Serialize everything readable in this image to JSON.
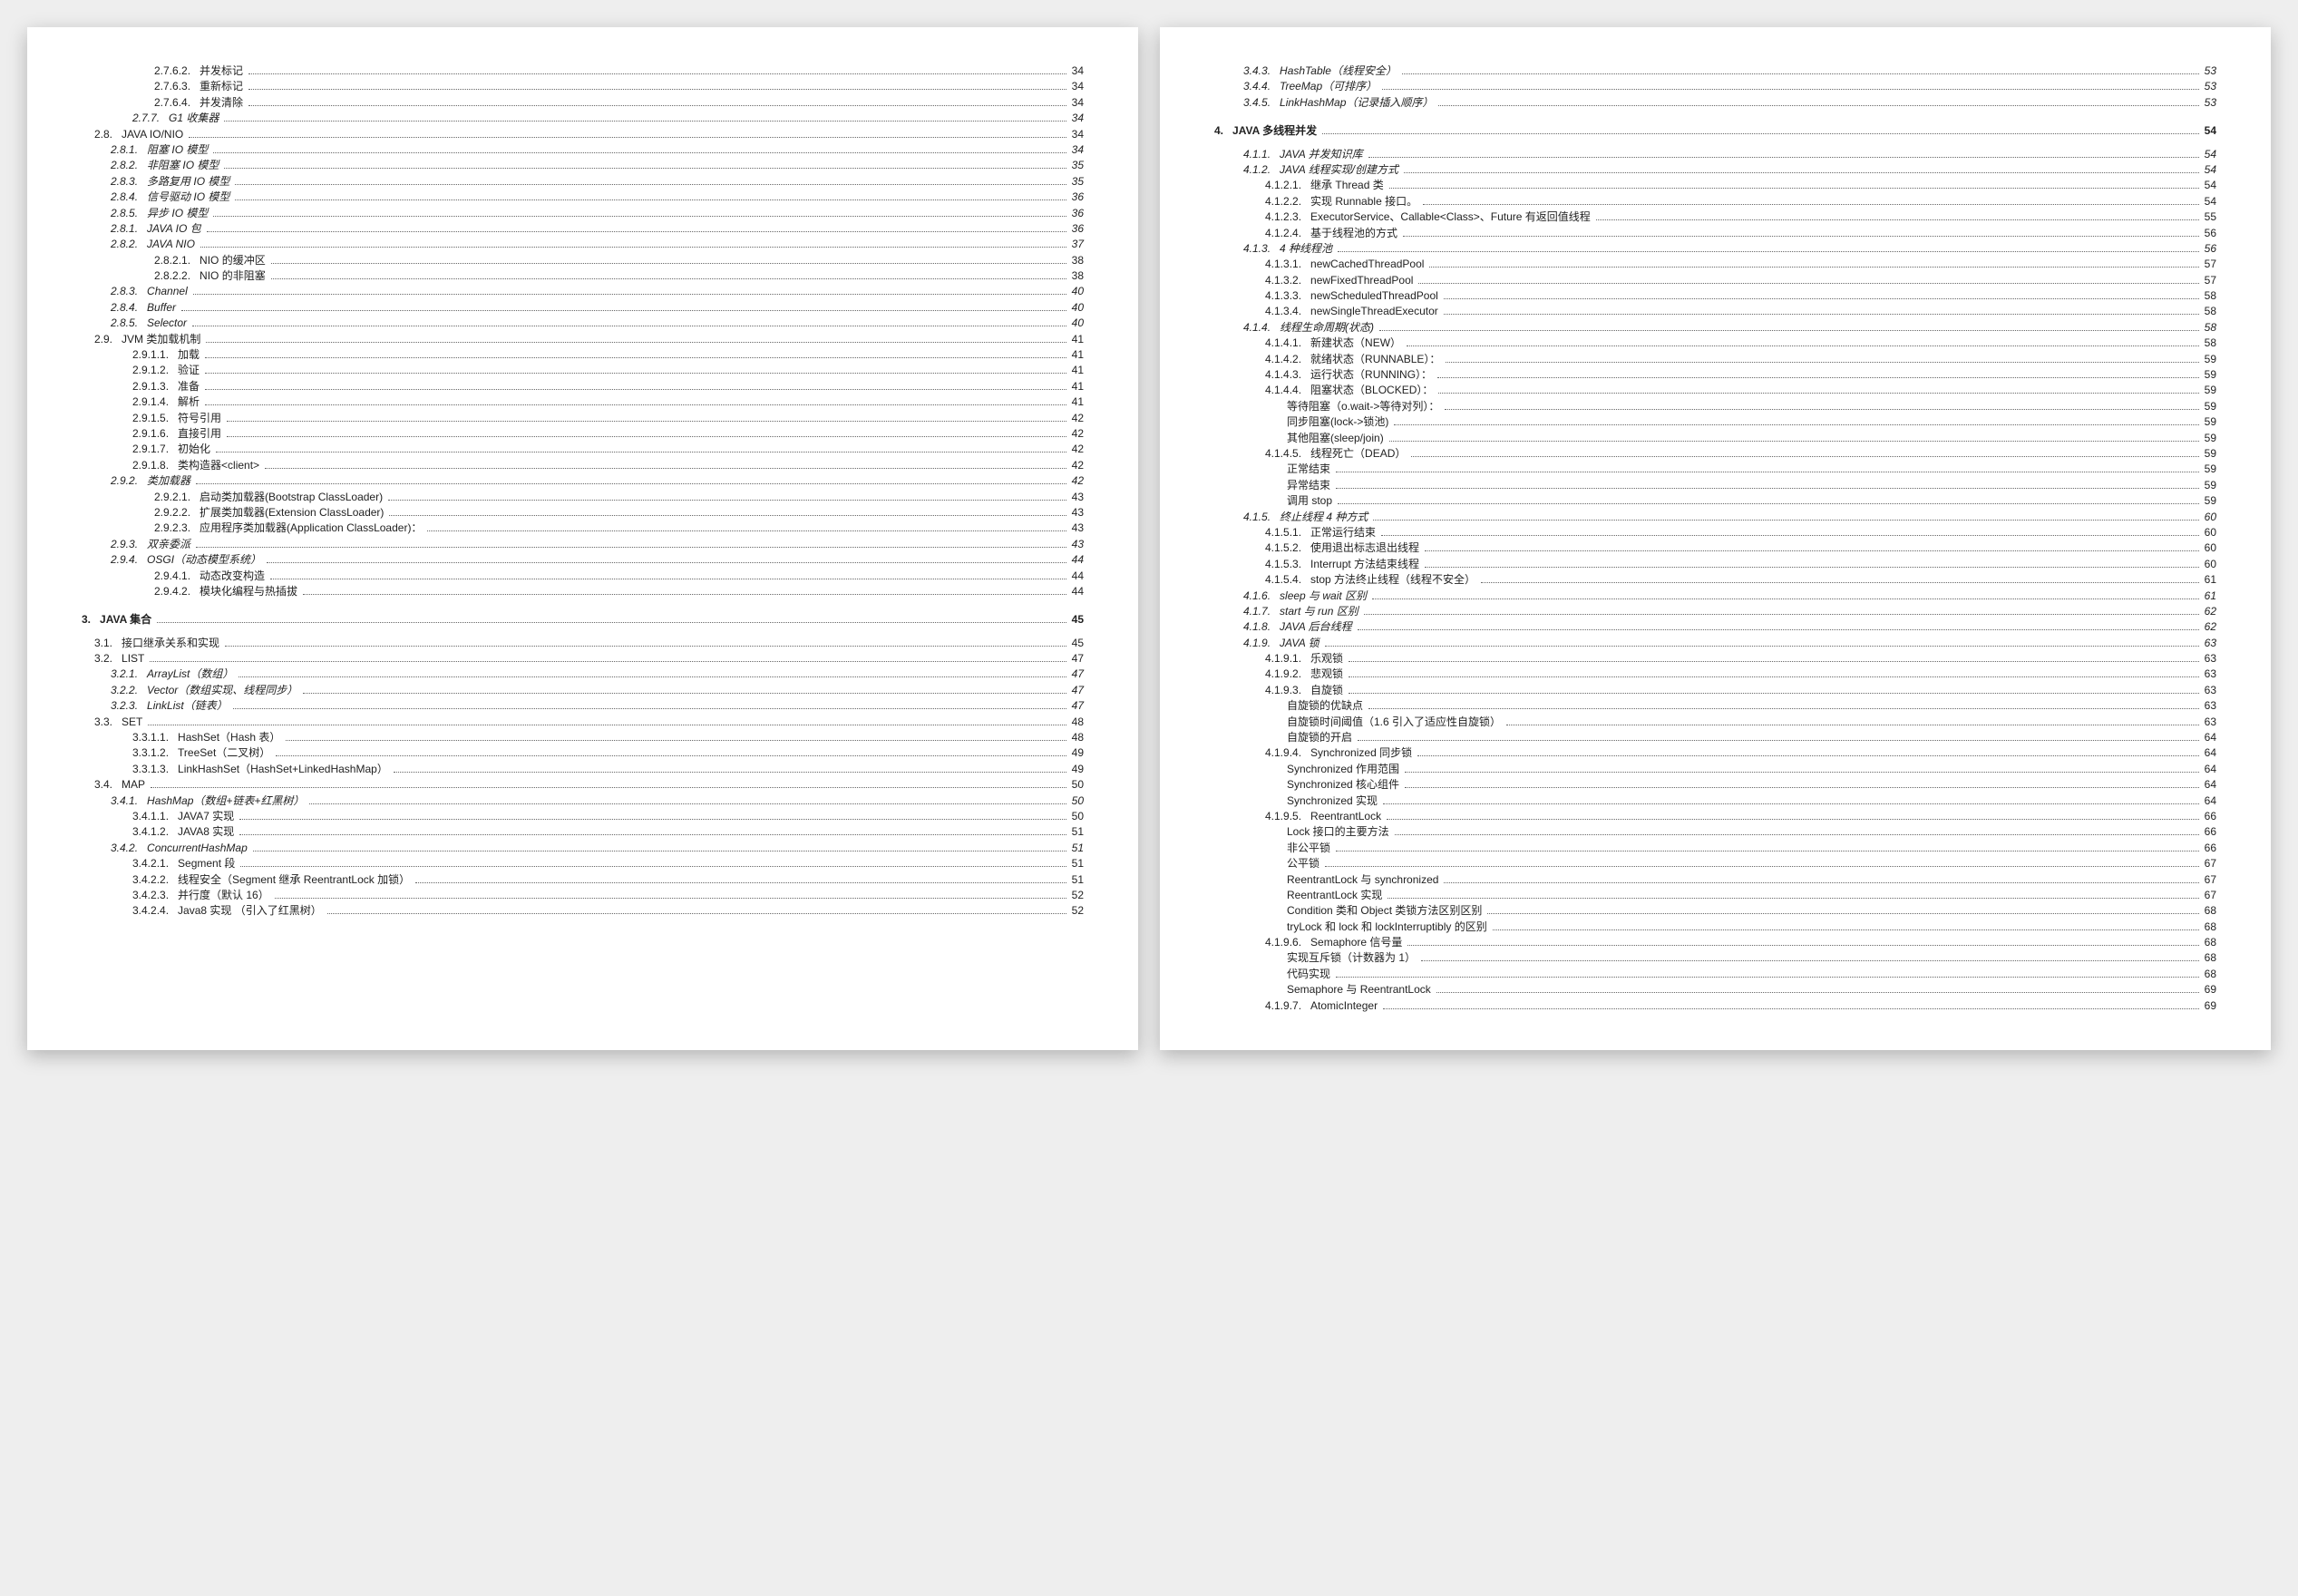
{
  "left": [
    {
      "lvl": "lvl4",
      "num": "2.7.6.2.",
      "label": "并发标记",
      "pg": "34"
    },
    {
      "lvl": "lvl4",
      "num": "2.7.6.3.",
      "label": "重新标记",
      "pg": "34"
    },
    {
      "lvl": "lvl4",
      "num": "2.7.6.4.",
      "label": "并发清除",
      "pg": "34"
    },
    {
      "lvl": "lvl3",
      "num": "2.7.7.",
      "label": "G1 收集器",
      "pg": "34",
      "ital": true
    },
    {
      "lvl": "lvl1",
      "num": "2.8.",
      "label": "JAVA IO/NIO",
      "pg": "34"
    },
    {
      "lvl": "lvl2",
      "num": "2.8.1.",
      "label": "阻塞 IO 模型",
      "pg": "34"
    },
    {
      "lvl": "lvl2",
      "num": "2.8.2.",
      "label": "非阻塞 IO 模型",
      "pg": "35"
    },
    {
      "lvl": "lvl2",
      "num": "2.8.3.",
      "label": "多路复用 IO 模型",
      "pg": "35"
    },
    {
      "lvl": "lvl2",
      "num": "2.8.4.",
      "label": "信号驱动 IO 模型",
      "pg": "36"
    },
    {
      "lvl": "lvl2",
      "num": "2.8.5.",
      "label": "异步 IO 模型",
      "pg": "36"
    },
    {
      "lvl": "lvl2",
      "num": "2.8.1.",
      "label": "JAVA IO 包",
      "pg": "36"
    },
    {
      "lvl": "lvl2",
      "num": "2.8.2.",
      "label": "JAVA NIO",
      "pg": "37"
    },
    {
      "lvl": "lvl4",
      "num": "2.8.2.1.",
      "label": "NIO 的缓冲区",
      "pg": "38"
    },
    {
      "lvl": "lvl4",
      "num": "2.8.2.2.",
      "label": "NIO 的非阻塞",
      "pg": "38"
    },
    {
      "lvl": "lvl2",
      "num": "2.8.3.",
      "label": "Channel",
      "pg": "40"
    },
    {
      "lvl": "lvl2",
      "num": "2.8.4.",
      "label": "Buffer",
      "pg": "40"
    },
    {
      "lvl": "lvl2",
      "num": "2.8.5.",
      "label": "Selector",
      "pg": "40"
    },
    {
      "lvl": "lvl1",
      "num": "2.9.",
      "label": "JVM 类加载机制",
      "pg": "41"
    },
    {
      "lvl": "lvl3",
      "num": "2.9.1.1.",
      "label": "加载",
      "pg": "41"
    },
    {
      "lvl": "lvl3",
      "num": "2.9.1.2.",
      "label": "验证",
      "pg": "41"
    },
    {
      "lvl": "lvl3",
      "num": "2.9.1.3.",
      "label": "准备",
      "pg": "41"
    },
    {
      "lvl": "lvl3",
      "num": "2.9.1.4.",
      "label": "解析",
      "pg": "41"
    },
    {
      "lvl": "lvl3",
      "num": "2.9.1.5.",
      "label": "符号引用",
      "pg": "42"
    },
    {
      "lvl": "lvl3",
      "num": "2.9.1.6.",
      "label": "直接引用",
      "pg": "42"
    },
    {
      "lvl": "lvl3",
      "num": "2.9.1.7.",
      "label": "初始化",
      "pg": "42"
    },
    {
      "lvl": "lvl3",
      "num": "2.9.1.8.",
      "label": "类构造器<client>",
      "pg": "42"
    },
    {
      "lvl": "lvl2",
      "num": "2.9.2.",
      "label": "类加载器",
      "pg": "42"
    },
    {
      "lvl": "lvl4",
      "num": "2.9.2.1.",
      "label": "启动类加载器(Bootstrap ClassLoader)",
      "pg": "43"
    },
    {
      "lvl": "lvl4",
      "num": "2.9.2.2.",
      "label": "扩展类加载器(Extension ClassLoader)",
      "pg": "43"
    },
    {
      "lvl": "lvl4",
      "num": "2.9.2.3.",
      "label": "应用程序类加载器(Application ClassLoader)：",
      "pg": "43"
    },
    {
      "lvl": "lvl2",
      "num": "2.9.3.",
      "label": "双亲委派",
      "pg": "43"
    },
    {
      "lvl": "lvl2",
      "num": "2.9.4.",
      "label": "OSGI（动态模型系统）",
      "pg": "44"
    },
    {
      "lvl": "lvl4",
      "num": "2.9.4.1.",
      "label": "动态改变构造",
      "pg": "44"
    },
    {
      "lvl": "lvl4",
      "num": "2.9.4.2.",
      "label": "模块化编程与热插拔",
      "pg": "44"
    },
    {
      "lvl": "lvl0",
      "num": "3.",
      "label": "JAVA 集合",
      "pg": "45"
    },
    {
      "lvl": "lvl1",
      "num": "3.1.",
      "label": "接口继承关系和实现",
      "pg": "45"
    },
    {
      "lvl": "lvl1",
      "num": "3.2.",
      "label": "LIST",
      "pg": "47",
      "sc": true
    },
    {
      "lvl": "lvl2",
      "num": "3.2.1.",
      "label": "ArrayList（数组）",
      "pg": "47"
    },
    {
      "lvl": "lvl2",
      "num": "3.2.2.",
      "label": "Vector（数组实现、线程同步）",
      "pg": "47"
    },
    {
      "lvl": "lvl2",
      "num": "3.2.3.",
      "label": "LinkList（链表）",
      "pg": "47"
    },
    {
      "lvl": "lvl1",
      "num": "3.3.",
      "label": "SET",
      "pg": "48",
      "sc": true
    },
    {
      "lvl": "lvl3",
      "num": "3.3.1.1.",
      "label": "HashSet（Hash 表）",
      "pg": "48"
    },
    {
      "lvl": "lvl3",
      "num": "3.3.1.2.",
      "label": "TreeSet（二叉树）",
      "pg": "49"
    },
    {
      "lvl": "lvl3",
      "num": "3.3.1.3.",
      "label": "LinkHashSet（HashSet+LinkedHashMap）",
      "pg": "49"
    },
    {
      "lvl": "lvl1",
      "num": "3.4.",
      "label": "MAP",
      "pg": "50",
      "sc": true
    },
    {
      "lvl": "lvl2",
      "num": "3.4.1.",
      "label": "HashMap（数组+链表+红黑树）",
      "pg": "50"
    },
    {
      "lvl": "lvl3",
      "num": "3.4.1.1.",
      "label": "JAVA7 实现",
      "pg": "50"
    },
    {
      "lvl": "lvl3",
      "num": "3.4.1.2.",
      "label": "JAVA8 实现",
      "pg": "51"
    },
    {
      "lvl": "lvl2",
      "num": "3.4.2.",
      "label": "ConcurrentHashMap",
      "pg": "51"
    },
    {
      "lvl": "lvl3",
      "num": "3.4.2.1.",
      "label": "Segment 段",
      "pg": "51"
    },
    {
      "lvl": "lvl3",
      "num": "3.4.2.2.",
      "label": "线程安全（Segment 继承 ReentrantLock 加锁）",
      "pg": "51"
    },
    {
      "lvl": "lvl3",
      "num": "3.4.2.3.",
      "label": "并行度（默认 16）",
      "pg": "52"
    },
    {
      "lvl": "lvl3",
      "num": "3.4.2.4.",
      "label": "Java8 实现 （引入了红黑树）",
      "pg": "52"
    }
  ],
  "right": [
    {
      "lvl": "lvl2",
      "num": "3.4.3.",
      "label": "HashTable（线程安全）",
      "pg": "53"
    },
    {
      "lvl": "lvl2",
      "num": "3.4.4.",
      "label": "TreeMap（可排序）",
      "pg": "53"
    },
    {
      "lvl": "lvl2",
      "num": "3.4.5.",
      "label": "LinkHashMap（记录插入顺序）",
      "pg": "53"
    },
    {
      "lvl": "lvl0",
      "num": "4.",
      "label": "JAVA 多线程并发",
      "pg": "54"
    },
    {
      "lvl": "lvl2",
      "num": "4.1.1.",
      "label": "JAVA 并发知识库",
      "pg": "54"
    },
    {
      "lvl": "lvl2",
      "num": "4.1.2.",
      "label": "JAVA 线程实现/创建方式",
      "pg": "54"
    },
    {
      "lvl": "lvl3",
      "num": "4.1.2.1.",
      "label": "继承 Thread 类",
      "pg": "54"
    },
    {
      "lvl": "lvl3",
      "num": "4.1.2.2.",
      "label": "实现 Runnable 接口。",
      "pg": "54"
    },
    {
      "lvl": "lvl3",
      "num": "4.1.2.3.",
      "label": "ExecutorService、Callable<Class>、Future 有返回值线程",
      "pg": "55"
    },
    {
      "lvl": "lvl3",
      "num": "4.1.2.4.",
      "label": "基于线程池的方式",
      "pg": "56"
    },
    {
      "lvl": "lvl2",
      "num": "4.1.3.",
      "label": "4 种线程池",
      "pg": "56"
    },
    {
      "lvl": "lvl3",
      "num": "4.1.3.1.",
      "label": "newCachedThreadPool",
      "pg": "57"
    },
    {
      "lvl": "lvl3",
      "num": "4.1.3.2.",
      "label": "newFixedThreadPool",
      "pg": "57"
    },
    {
      "lvl": "lvl3",
      "num": "4.1.3.3.",
      "label": "newScheduledThreadPool",
      "pg": "58"
    },
    {
      "lvl": "lvl3",
      "num": "4.1.3.4.",
      "label": "newSingleThreadExecutor",
      "pg": "58"
    },
    {
      "lvl": "lvl2",
      "num": "4.1.4.",
      "label": "线程生命周期(状态)",
      "pg": "58"
    },
    {
      "lvl": "lvl3",
      "num": "4.1.4.1.",
      "label": "新建状态（NEW）",
      "pg": "58"
    },
    {
      "lvl": "lvl3",
      "num": "4.1.4.2.",
      "label": "就绪状态（RUNNABLE）：",
      "pg": "59"
    },
    {
      "lvl": "lvl3",
      "num": "4.1.4.3.",
      "label": "运行状态（RUNNING）：",
      "pg": "59"
    },
    {
      "lvl": "lvl3",
      "num": "4.1.4.4.",
      "label": "阻塞状态（BLOCKED）：",
      "pg": "59"
    },
    {
      "lvl": "lvl4",
      "num": "",
      "label": "等待阻塞（o.wait->等待对列）：",
      "pg": "59"
    },
    {
      "lvl": "lvl4",
      "num": "",
      "label": "同步阻塞(lock->锁池)",
      "pg": "59"
    },
    {
      "lvl": "lvl4",
      "num": "",
      "label": "其他阻塞(sleep/join)",
      "pg": "59"
    },
    {
      "lvl": "lvl3",
      "num": "4.1.4.5.",
      "label": "线程死亡（DEAD）",
      "pg": "59"
    },
    {
      "lvl": "lvl4",
      "num": "",
      "label": "正常结束",
      "pg": "59"
    },
    {
      "lvl": "lvl4",
      "num": "",
      "label": "异常结束",
      "pg": "59"
    },
    {
      "lvl": "lvl4",
      "num": "",
      "label": "调用 stop",
      "pg": "59"
    },
    {
      "lvl": "lvl2",
      "num": "4.1.5.",
      "label": "终止线程 4 种方式",
      "pg": "60"
    },
    {
      "lvl": "lvl3",
      "num": "4.1.5.1.",
      "label": "正常运行结束",
      "pg": "60"
    },
    {
      "lvl": "lvl3",
      "num": "4.1.5.2.",
      "label": "使用退出标志退出线程",
      "pg": "60"
    },
    {
      "lvl": "lvl3",
      "num": "4.1.5.3.",
      "label": "Interrupt 方法结束线程",
      "pg": "60"
    },
    {
      "lvl": "lvl3",
      "num": "4.1.5.4.",
      "label": "stop 方法终止线程（线程不安全）",
      "pg": "61"
    },
    {
      "lvl": "lvl2",
      "num": "4.1.6.",
      "label": "sleep 与 wait 区别",
      "pg": "61"
    },
    {
      "lvl": "lvl2",
      "num": "4.1.7.",
      "label": "start 与 run 区别",
      "pg": "62"
    },
    {
      "lvl": "lvl2",
      "num": "4.1.8.",
      "label": "JAVA 后台线程",
      "pg": "62"
    },
    {
      "lvl": "lvl2",
      "num": "4.1.9.",
      "label": "JAVA 锁",
      "pg": "63"
    },
    {
      "lvl": "lvl3",
      "num": "4.1.9.1.",
      "label": "乐观锁",
      "pg": "63"
    },
    {
      "lvl": "lvl3",
      "num": "4.1.9.2.",
      "label": "悲观锁",
      "pg": "63"
    },
    {
      "lvl": "lvl3",
      "num": "4.1.9.3.",
      "label": "自旋锁",
      "pg": "63"
    },
    {
      "lvl": "lvl4",
      "num": "",
      "label": "自旋锁的优缺点",
      "pg": "63"
    },
    {
      "lvl": "lvl4",
      "num": "",
      "label": "自旋锁时间阈值（1.6 引入了适应性自旋锁）",
      "pg": "63"
    },
    {
      "lvl": "lvl4",
      "num": "",
      "label": "自旋锁的开启",
      "pg": "64"
    },
    {
      "lvl": "lvl3",
      "num": "4.1.9.4.",
      "label": "Synchronized 同步锁",
      "pg": "64"
    },
    {
      "lvl": "lvl4",
      "num": "",
      "label": "Synchronized 作用范围",
      "pg": "64"
    },
    {
      "lvl": "lvl4",
      "num": "",
      "label": "Synchronized 核心组件",
      "pg": "64"
    },
    {
      "lvl": "lvl4",
      "num": "",
      "label": "Synchronized 实现",
      "pg": "64"
    },
    {
      "lvl": "lvl3",
      "num": "4.1.9.5.",
      "label": "ReentrantLock",
      "pg": "66"
    },
    {
      "lvl": "lvl4",
      "num": "",
      "label": "Lock 接口的主要方法",
      "pg": "66"
    },
    {
      "lvl": "lvl4",
      "num": "",
      "label": "非公平锁",
      "pg": "66"
    },
    {
      "lvl": "lvl4",
      "num": "",
      "label": "公平锁",
      "pg": "67"
    },
    {
      "lvl": "lvl4",
      "num": "",
      "label": "ReentrantLock 与 synchronized",
      "pg": "67"
    },
    {
      "lvl": "lvl4",
      "num": "",
      "label": "ReentrantLock 实现",
      "pg": "67"
    },
    {
      "lvl": "lvl4",
      "num": "",
      "label": "Condition 类和 Object 类锁方法区别区别",
      "pg": "68"
    },
    {
      "lvl": "lvl4",
      "num": "",
      "label": "tryLock 和 lock 和 lockInterruptibly 的区别",
      "pg": "68"
    },
    {
      "lvl": "lvl3",
      "num": "4.1.9.6.",
      "label": "Semaphore 信号量",
      "pg": "68"
    },
    {
      "lvl": "lvl4",
      "num": "",
      "label": "实现互斥锁（计数器为 1）",
      "pg": "68"
    },
    {
      "lvl": "lvl4",
      "num": "",
      "label": "代码实现",
      "pg": "68"
    },
    {
      "lvl": "lvl4",
      "num": "",
      "label": "Semaphore 与 ReentrantLock",
      "pg": "69"
    },
    {
      "lvl": "lvl3",
      "num": "4.1.9.7.",
      "label": "AtomicInteger",
      "pg": "69"
    }
  ]
}
